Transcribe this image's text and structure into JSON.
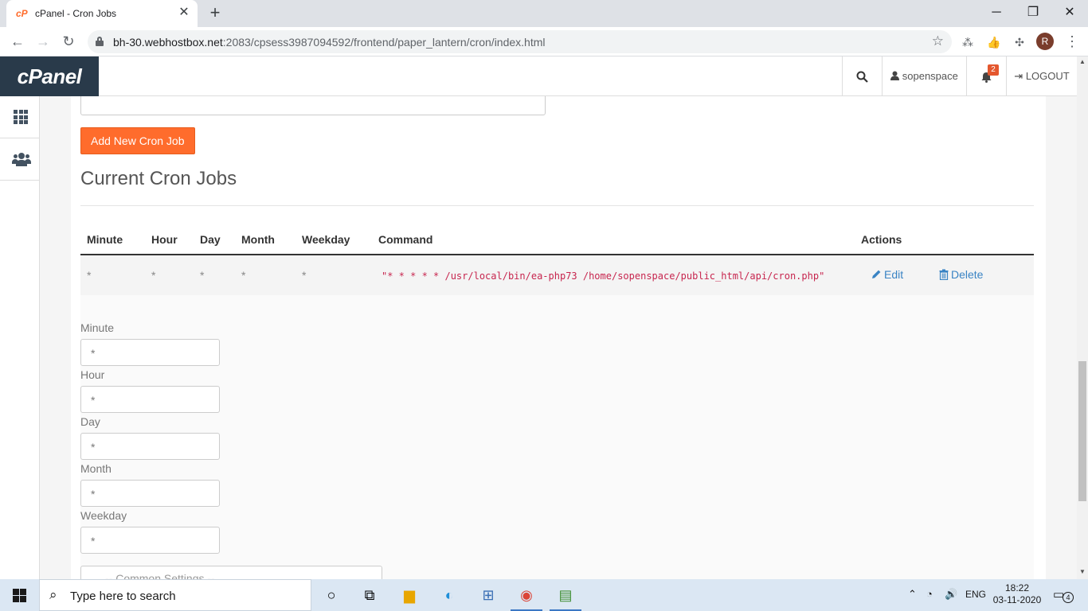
{
  "browser": {
    "tab_title": "cPanel - Cron Jobs",
    "tab_favicon": "cP",
    "url_host": "bh-30.webhostbox.net",
    "url_rest": ":2083/cpsess3987094592/frontend/paper_lantern/cron/index.html",
    "profile_initial": "R"
  },
  "header": {
    "logo": "cPanel",
    "username": "sopenspace",
    "notification_count": "2",
    "logout_label": "LOGOUT"
  },
  "main": {
    "add_button": "Add New Cron Job",
    "section_title": "Current Cron Jobs",
    "columns": [
      "Minute",
      "Hour",
      "Day",
      "Month",
      "Weekday",
      "Command",
      "Actions"
    ],
    "job": {
      "minute": "*",
      "hour": "*",
      "day": "*",
      "month": "*",
      "weekday": "*",
      "command": "\"* * * * * /usr/local/bin/ea-php73 /home/sopenspace/public_html/api/cron.php\"",
      "edit_label": "Edit",
      "delete_label": "Delete"
    },
    "edit_form": {
      "minute_label": "Minute",
      "minute_value": "*",
      "hour_label": "Hour",
      "hour_value": "*",
      "day_label": "Day",
      "day_value": "*",
      "month_label": "Month",
      "month_value": "*",
      "weekday_label": "Weekday",
      "weekday_value": "*",
      "common_settings": "-- Common Settings --"
    }
  },
  "taskbar": {
    "search_placeholder": "Type here to search",
    "language": "ENG",
    "time": "18:22",
    "date": "03-11-2020",
    "notification_count": "4"
  },
  "colors": {
    "cpanel_orange": "#ff6c2c",
    "cpanel_navy": "#293a4a",
    "link_blue": "#3a84c4",
    "code_red": "#c7254e"
  }
}
